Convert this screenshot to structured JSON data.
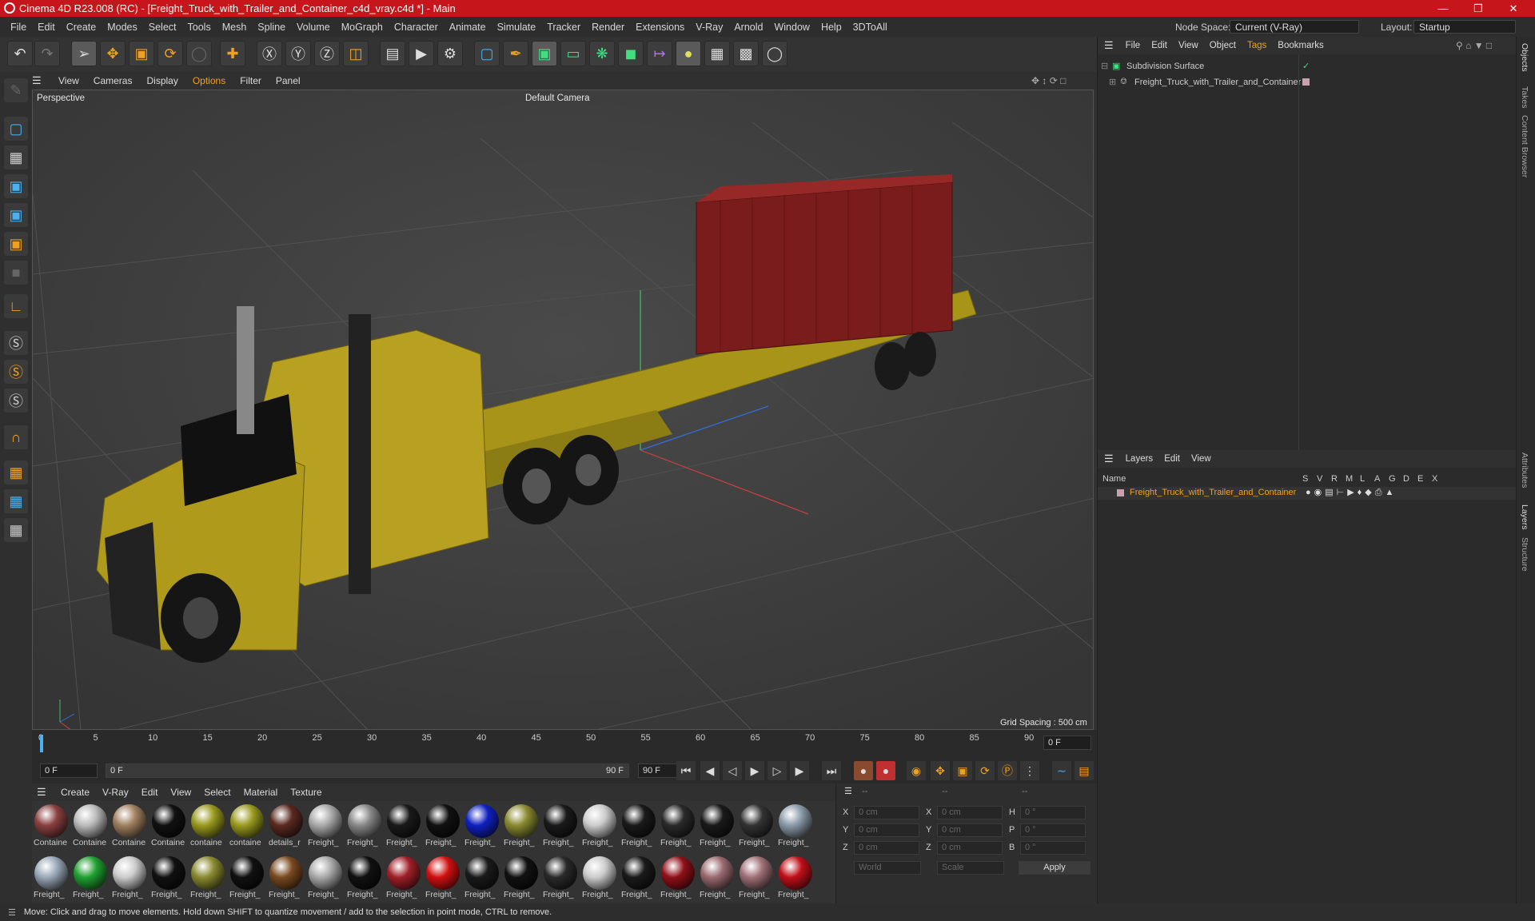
{
  "window": {
    "title": "Cinema 4D R23.008 (RC) - [Freight_Truck_with_Trailer_and_Container_c4d_vray.c4d *] - Main"
  },
  "menubar": {
    "items": [
      "File",
      "Edit",
      "Create",
      "Modes",
      "Select",
      "Tools",
      "Mesh",
      "Spline",
      "Volume",
      "MoGraph",
      "Character",
      "Animate",
      "Simulate",
      "Tracker",
      "Render",
      "Extensions",
      "V-Ray",
      "Arnold",
      "Window",
      "Help",
      "3DToAll"
    ],
    "node_space_label": "Node Space:",
    "node_space_value": "Current (V-Ray)",
    "layout_label": "Layout:",
    "layout_value": "Startup"
  },
  "viewport": {
    "menu": [
      "View",
      "Cameras",
      "Display",
      "Options",
      "Filter",
      "Panel"
    ],
    "name": "Perspective",
    "camera": "Default Camera",
    "grid_spacing": "Grid Spacing : 500 cm"
  },
  "timeline": {
    "ticks": [
      "0",
      "5",
      "10",
      "15",
      "20",
      "25",
      "30",
      "35",
      "40",
      "45",
      "50",
      "55",
      "60",
      "65",
      "70",
      "75",
      "80",
      "85",
      "90"
    ],
    "current": "0 F"
  },
  "transport": {
    "start": "0 F",
    "range_start": "0 F",
    "range_end": "90 F",
    "end": "90 F"
  },
  "materials": {
    "menu": [
      "Create",
      "V-Ray",
      "Edit",
      "View",
      "Select",
      "Material",
      "Texture"
    ],
    "row1": [
      {
        "name": "Containe",
        "color": "#8a4040"
      },
      {
        "name": "Containe",
        "color": "#bbbbbb"
      },
      {
        "name": "Containe",
        "color": "#a08060"
      },
      {
        "name": "Containe",
        "color": "#111111"
      },
      {
        "name": "containe",
        "color": "#9a9a20"
      },
      {
        "name": "containe",
        "color": "#9a9a20"
      },
      {
        "name": "details_r",
        "color": "#5a2a20"
      },
      {
        "name": "Freight_",
        "color": "#aaaaaa"
      },
      {
        "name": "Freight_",
        "color": "#888888"
      },
      {
        "name": "Freight_",
        "color": "#1a1a1a"
      },
      {
        "name": "Freight_",
        "color": "#111111"
      },
      {
        "name": "Freight_",
        "color": "#1020c0"
      },
      {
        "name": "Freight_",
        "color": "#8a8a30"
      },
      {
        "name": "Freight_",
        "color": "#1a1a1a"
      },
      {
        "name": "Freight_",
        "color": "#cccccc"
      },
      {
        "name": "Freight_",
        "color": "#1a1a1a"
      },
      {
        "name": "Freight_",
        "color": "#2a2a2a"
      },
      {
        "name": "Freight_",
        "color": "#1a1a1a"
      },
      {
        "name": "Freight_",
        "color": "#333333"
      },
      {
        "name": "Freight_",
        "color": "#8a9aa8"
      }
    ],
    "row2": [
      {
        "name": "Freight_",
        "color": "#9aa8b8"
      },
      {
        "name": "Freight_",
        "color": "#20a030"
      },
      {
        "name": "Freight_",
        "color": "#cccccc"
      },
      {
        "name": "Freight_",
        "color": "#111111"
      },
      {
        "name": "Freight_",
        "color": "#8a8a30"
      },
      {
        "name": "Freight_",
        "color": "#111111"
      },
      {
        "name": "Freight_",
        "color": "#7a4a20"
      },
      {
        "name": "Freight_",
        "color": "#aaaaaa"
      },
      {
        "name": "Freight_",
        "color": "#111111"
      },
      {
        "name": "Freight_",
        "color": "#a02028"
      },
      {
        "name": "Freight_",
        "color": "#d01010"
      },
      {
        "name": "Freight_",
        "color": "#1a1a1a"
      },
      {
        "name": "Freight_",
        "color": "#111111"
      },
      {
        "name": "Freight_",
        "color": "#2a2a2a"
      },
      {
        "name": "Freight_",
        "color": "#cccccc"
      },
      {
        "name": "Freight_",
        "color": "#1a1a1a"
      },
      {
        "name": "Freight_",
        "color": "#901018"
      },
      {
        "name": "Freight_",
        "color": "#9a6a70"
      },
      {
        "name": "Freight_",
        "color": "#a07078"
      },
      {
        "name": "Freight_",
        "color": "#c01018"
      }
    ]
  },
  "coords": {
    "head": [
      "--",
      "--",
      "--"
    ],
    "x": "0 cm",
    "y": "0 cm",
    "z": "0 cm",
    "x2": "0 cm",
    "y2": "0 cm",
    "z2": "0 cm",
    "h": "0 °",
    "p": "0 °",
    "b": "0 °",
    "world": "World",
    "scale": "Scale",
    "apply": "Apply",
    "labels": [
      "X",
      "Y",
      "Z",
      "X",
      "Y",
      "Z",
      "H",
      "P",
      "B"
    ]
  },
  "objects": {
    "menu": [
      "File",
      "Edit",
      "View",
      "Object",
      "Tags",
      "Bookmarks"
    ],
    "items": [
      "Subdivision Surface",
      "Freight_Truck_with_Trailer_and_Container"
    ]
  },
  "layers": {
    "menu": [
      "Layers",
      "Edit",
      "View"
    ],
    "name_col": "Name",
    "cols": [
      "S",
      "V",
      "R",
      "M",
      "L",
      "A",
      "G",
      "D",
      "E",
      "X"
    ],
    "item": "Freight_Truck_with_Trailer_and_Container"
  },
  "right_tabs": [
    "Objects",
    "Takes",
    "Content Browser",
    "Attributes",
    "Layers",
    "Structure"
  ],
  "status": "Move: Click and drag to move elements. Hold down SHIFT to quantize movement / add to the selection in point mode, CTRL to remove.",
  "colors": {
    "title_red": "#c6151b",
    "accent_orange": "#f0a020",
    "truck_yellow": "#b8a020",
    "container_red": "#7a1c1c"
  }
}
